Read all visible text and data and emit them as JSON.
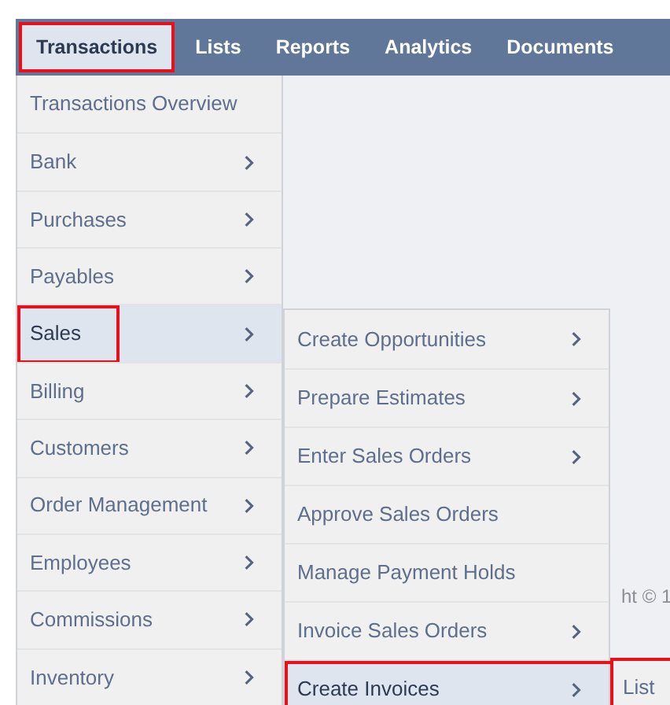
{
  "nav": {
    "tabs": [
      {
        "label": "Transactions",
        "selected": true,
        "outlined": true
      },
      {
        "label": "Lists",
        "selected": false,
        "outlined": false
      },
      {
        "label": "Reports",
        "selected": false,
        "outlined": false
      },
      {
        "label": "Analytics",
        "selected": false,
        "outlined": false
      },
      {
        "label": "Documents",
        "selected": false,
        "outlined": false
      }
    ]
  },
  "menu": {
    "items": [
      {
        "label": "Transactions Overview",
        "submenu": false,
        "selected": false,
        "outlined": false
      },
      {
        "label": "Bank",
        "submenu": true,
        "selected": false,
        "outlined": false
      },
      {
        "label": "Purchases",
        "submenu": true,
        "selected": false,
        "outlined": false
      },
      {
        "label": "Payables",
        "submenu": true,
        "selected": false,
        "outlined": false
      },
      {
        "label": "Sales",
        "submenu": true,
        "selected": true,
        "outlined": true
      },
      {
        "label": "Billing",
        "submenu": true,
        "selected": false,
        "outlined": false
      },
      {
        "label": "Customers",
        "submenu": true,
        "selected": false,
        "outlined": false
      },
      {
        "label": "Order Management",
        "submenu": true,
        "selected": false,
        "outlined": false
      },
      {
        "label": "Employees",
        "submenu": true,
        "selected": false,
        "outlined": false
      },
      {
        "label": "Commissions",
        "submenu": true,
        "selected": false,
        "outlined": false
      },
      {
        "label": "Inventory",
        "submenu": true,
        "selected": false,
        "outlined": false
      }
    ]
  },
  "submenu": {
    "items": [
      {
        "label": "Create Opportunities",
        "submenu": true,
        "selected": false,
        "outlined": false
      },
      {
        "label": "Prepare Estimates",
        "submenu": true,
        "selected": false,
        "outlined": false
      },
      {
        "label": "Enter Sales Orders",
        "submenu": true,
        "selected": false,
        "outlined": false
      },
      {
        "label": "Approve Sales Orders",
        "submenu": false,
        "selected": false,
        "outlined": false
      },
      {
        "label": "Manage Payment Holds",
        "submenu": false,
        "selected": false,
        "outlined": false
      },
      {
        "label": "Invoice Sales Orders",
        "submenu": true,
        "selected": false,
        "outlined": false
      },
      {
        "label": "Create Invoices",
        "submenu": true,
        "selected": true,
        "outlined": true
      }
    ]
  },
  "third_menu": {
    "items": [
      {
        "label": "List",
        "submenu": false,
        "selected": false,
        "outlined": true
      }
    ]
  },
  "footer": {
    "copyright": "ht © 1"
  }
}
